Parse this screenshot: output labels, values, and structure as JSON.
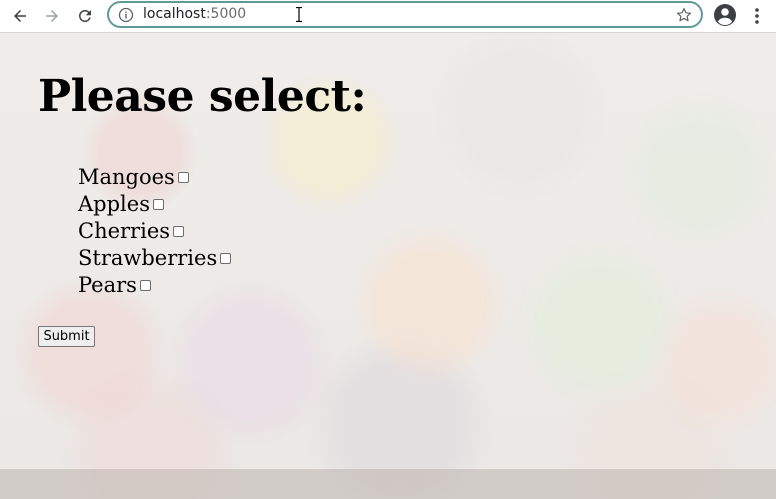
{
  "browser": {
    "url_host": "localhost",
    "url_port": ":5000",
    "icons": {
      "back": "arrow-left-icon",
      "forward": "arrow-right-icon",
      "reload": "reload-icon",
      "info": "info-icon",
      "bookmark": "star-icon",
      "profile": "account-circle-icon",
      "menu": "more-vert-icon"
    },
    "accent_color": "#5f9a96"
  },
  "page": {
    "title": "Please select:",
    "options": [
      {
        "label": "Mangoes",
        "checked": false
      },
      {
        "label": "Apples",
        "checked": false
      },
      {
        "label": "Cherries",
        "checked": false
      },
      {
        "label": "Strawberries",
        "checked": false
      },
      {
        "label": "Pears",
        "checked": false
      }
    ],
    "submit_label": "Submit"
  }
}
